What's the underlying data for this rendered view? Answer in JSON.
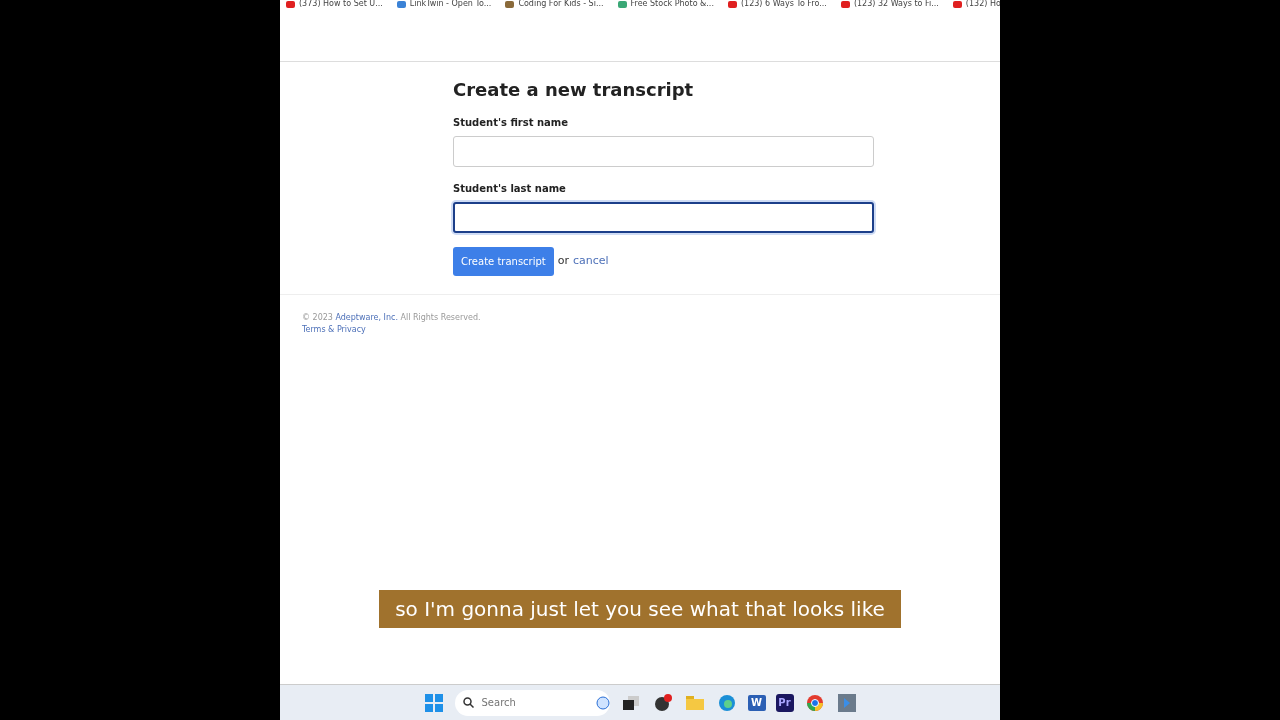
{
  "bookmarks": [
    {
      "label": "(373) How to Set U...",
      "color": "#e02020"
    },
    {
      "label": "LinkTwin - Open To...",
      "color": "#3b82d6"
    },
    {
      "label": "Coding For Kids - Si...",
      "color": "#8a6a3a"
    },
    {
      "label": "Free Stock Photo &...",
      "color": "#3aa876"
    },
    {
      "label": "(123) 6 Ways To Fro...",
      "color": "#e02020"
    },
    {
      "label": "(123) 32 Ways to Fi...",
      "color": "#e02020"
    },
    {
      "label": "(132) Ho",
      "color": "#e02020"
    }
  ],
  "form": {
    "title": "Create a new transcript",
    "fields": [
      {
        "label": "Student's first name",
        "focused": false
      },
      {
        "label": "Student's last name",
        "focused": true
      }
    ],
    "submit": "Create transcript",
    "or": "or",
    "cancel": "cancel"
  },
  "footer": {
    "copyright": "© 2023",
    "company": "Adeptware, Inc.",
    "rights": "All Rights Reserved.",
    "terms": "Terms & Privacy"
  },
  "caption": "so I'm gonna just let you see what that looks like",
  "taskbar": {
    "search": {
      "placeholder": "Search"
    },
    "word_label": "W",
    "premiere_label": "Pr"
  }
}
